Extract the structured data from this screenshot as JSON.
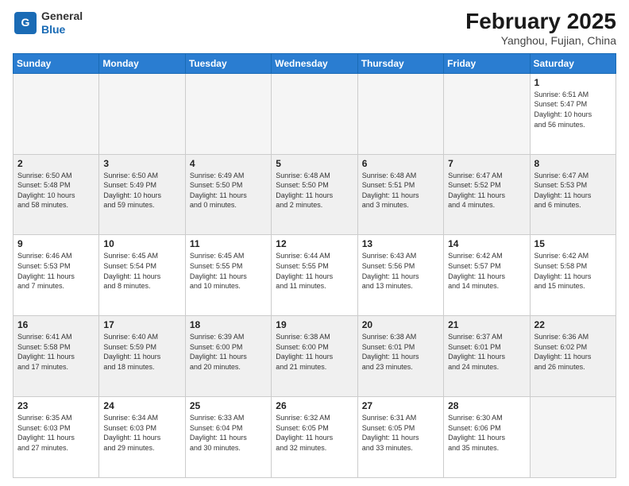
{
  "header": {
    "logo_general": "General",
    "logo_blue": "Blue",
    "month": "February 2025",
    "location": "Yanghou, Fujian, China"
  },
  "weekdays": [
    "Sunday",
    "Monday",
    "Tuesday",
    "Wednesday",
    "Thursday",
    "Friday",
    "Saturday"
  ],
  "weeks": [
    [
      {
        "day": "",
        "info": ""
      },
      {
        "day": "",
        "info": ""
      },
      {
        "day": "",
        "info": ""
      },
      {
        "day": "",
        "info": ""
      },
      {
        "day": "",
        "info": ""
      },
      {
        "day": "",
        "info": ""
      },
      {
        "day": "1",
        "info": "Sunrise: 6:51 AM\nSunset: 5:47 PM\nDaylight: 10 hours\nand 56 minutes."
      }
    ],
    [
      {
        "day": "2",
        "info": "Sunrise: 6:50 AM\nSunset: 5:48 PM\nDaylight: 10 hours\nand 58 minutes."
      },
      {
        "day": "3",
        "info": "Sunrise: 6:50 AM\nSunset: 5:49 PM\nDaylight: 10 hours\nand 59 minutes."
      },
      {
        "day": "4",
        "info": "Sunrise: 6:49 AM\nSunset: 5:50 PM\nDaylight: 11 hours\nand 0 minutes."
      },
      {
        "day": "5",
        "info": "Sunrise: 6:48 AM\nSunset: 5:50 PM\nDaylight: 11 hours\nand 2 minutes."
      },
      {
        "day": "6",
        "info": "Sunrise: 6:48 AM\nSunset: 5:51 PM\nDaylight: 11 hours\nand 3 minutes."
      },
      {
        "day": "7",
        "info": "Sunrise: 6:47 AM\nSunset: 5:52 PM\nDaylight: 11 hours\nand 4 minutes."
      },
      {
        "day": "8",
        "info": "Sunrise: 6:47 AM\nSunset: 5:53 PM\nDaylight: 11 hours\nand 6 minutes."
      }
    ],
    [
      {
        "day": "9",
        "info": "Sunrise: 6:46 AM\nSunset: 5:53 PM\nDaylight: 11 hours\nand 7 minutes."
      },
      {
        "day": "10",
        "info": "Sunrise: 6:45 AM\nSunset: 5:54 PM\nDaylight: 11 hours\nand 8 minutes."
      },
      {
        "day": "11",
        "info": "Sunrise: 6:45 AM\nSunset: 5:55 PM\nDaylight: 11 hours\nand 10 minutes."
      },
      {
        "day": "12",
        "info": "Sunrise: 6:44 AM\nSunset: 5:55 PM\nDaylight: 11 hours\nand 11 minutes."
      },
      {
        "day": "13",
        "info": "Sunrise: 6:43 AM\nSunset: 5:56 PM\nDaylight: 11 hours\nand 13 minutes."
      },
      {
        "day": "14",
        "info": "Sunrise: 6:42 AM\nSunset: 5:57 PM\nDaylight: 11 hours\nand 14 minutes."
      },
      {
        "day": "15",
        "info": "Sunrise: 6:42 AM\nSunset: 5:58 PM\nDaylight: 11 hours\nand 15 minutes."
      }
    ],
    [
      {
        "day": "16",
        "info": "Sunrise: 6:41 AM\nSunset: 5:58 PM\nDaylight: 11 hours\nand 17 minutes."
      },
      {
        "day": "17",
        "info": "Sunrise: 6:40 AM\nSunset: 5:59 PM\nDaylight: 11 hours\nand 18 minutes."
      },
      {
        "day": "18",
        "info": "Sunrise: 6:39 AM\nSunset: 6:00 PM\nDaylight: 11 hours\nand 20 minutes."
      },
      {
        "day": "19",
        "info": "Sunrise: 6:38 AM\nSunset: 6:00 PM\nDaylight: 11 hours\nand 21 minutes."
      },
      {
        "day": "20",
        "info": "Sunrise: 6:38 AM\nSunset: 6:01 PM\nDaylight: 11 hours\nand 23 minutes."
      },
      {
        "day": "21",
        "info": "Sunrise: 6:37 AM\nSunset: 6:01 PM\nDaylight: 11 hours\nand 24 minutes."
      },
      {
        "day": "22",
        "info": "Sunrise: 6:36 AM\nSunset: 6:02 PM\nDaylight: 11 hours\nand 26 minutes."
      }
    ],
    [
      {
        "day": "23",
        "info": "Sunrise: 6:35 AM\nSunset: 6:03 PM\nDaylight: 11 hours\nand 27 minutes."
      },
      {
        "day": "24",
        "info": "Sunrise: 6:34 AM\nSunset: 6:03 PM\nDaylight: 11 hours\nand 29 minutes."
      },
      {
        "day": "25",
        "info": "Sunrise: 6:33 AM\nSunset: 6:04 PM\nDaylight: 11 hours\nand 30 minutes."
      },
      {
        "day": "26",
        "info": "Sunrise: 6:32 AM\nSunset: 6:05 PM\nDaylight: 11 hours\nand 32 minutes."
      },
      {
        "day": "27",
        "info": "Sunrise: 6:31 AM\nSunset: 6:05 PM\nDaylight: 11 hours\nand 33 minutes."
      },
      {
        "day": "28",
        "info": "Sunrise: 6:30 AM\nSunset: 6:06 PM\nDaylight: 11 hours\nand 35 minutes."
      },
      {
        "day": "",
        "info": ""
      }
    ]
  ]
}
